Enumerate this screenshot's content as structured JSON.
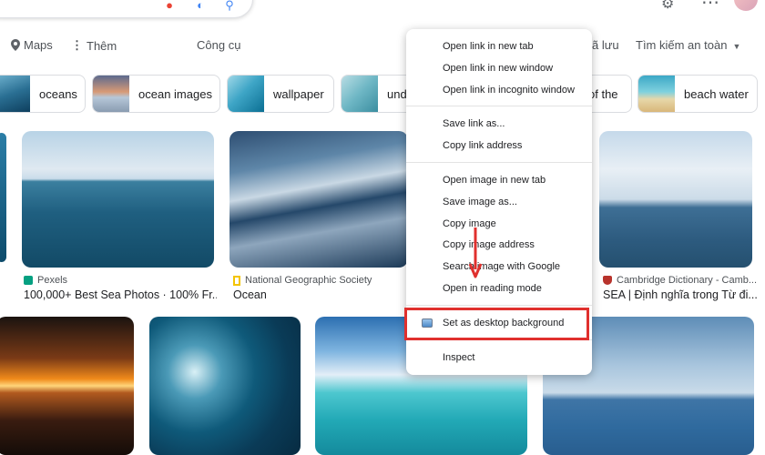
{
  "nav": {
    "maps_label": "Maps",
    "more_label": "Thêm",
    "tools_label": "Công cụ",
    "saved_label": "ã lưu",
    "safesearch_label": "Tìm kiếm an toàn"
  },
  "chips": [
    {
      "label": "oceans"
    },
    {
      "label": "ocean images"
    },
    {
      "label": "wallpaper"
    },
    {
      "label": "und"
    },
    {
      "label": "of the"
    },
    {
      "label": "beach water"
    }
  ],
  "results": [
    {
      "source": "Pexels",
      "title": "100,000+ Best Sea Photos · 100% Fr..."
    },
    {
      "source": "National Geographic Society",
      "title": "Ocean"
    },
    {
      "source": "Cambridge Dictionary - Camb...",
      "title": "SEA | Định nghĩa trong Từ đi..."
    }
  ],
  "context_menu": {
    "items": [
      "Open link in new tab",
      "Open link in new window",
      "Open link in incognito window",
      "Save link as...",
      "Copy link address",
      "Open image in new tab",
      "Save image as...",
      "Copy image",
      "Copy image address",
      "Search image with Google",
      "Open in reading mode",
      "Set as desktop background",
      "Inspect"
    ]
  },
  "colors": {
    "highlight": "#e0302e",
    "arrow": "#e0302e"
  }
}
